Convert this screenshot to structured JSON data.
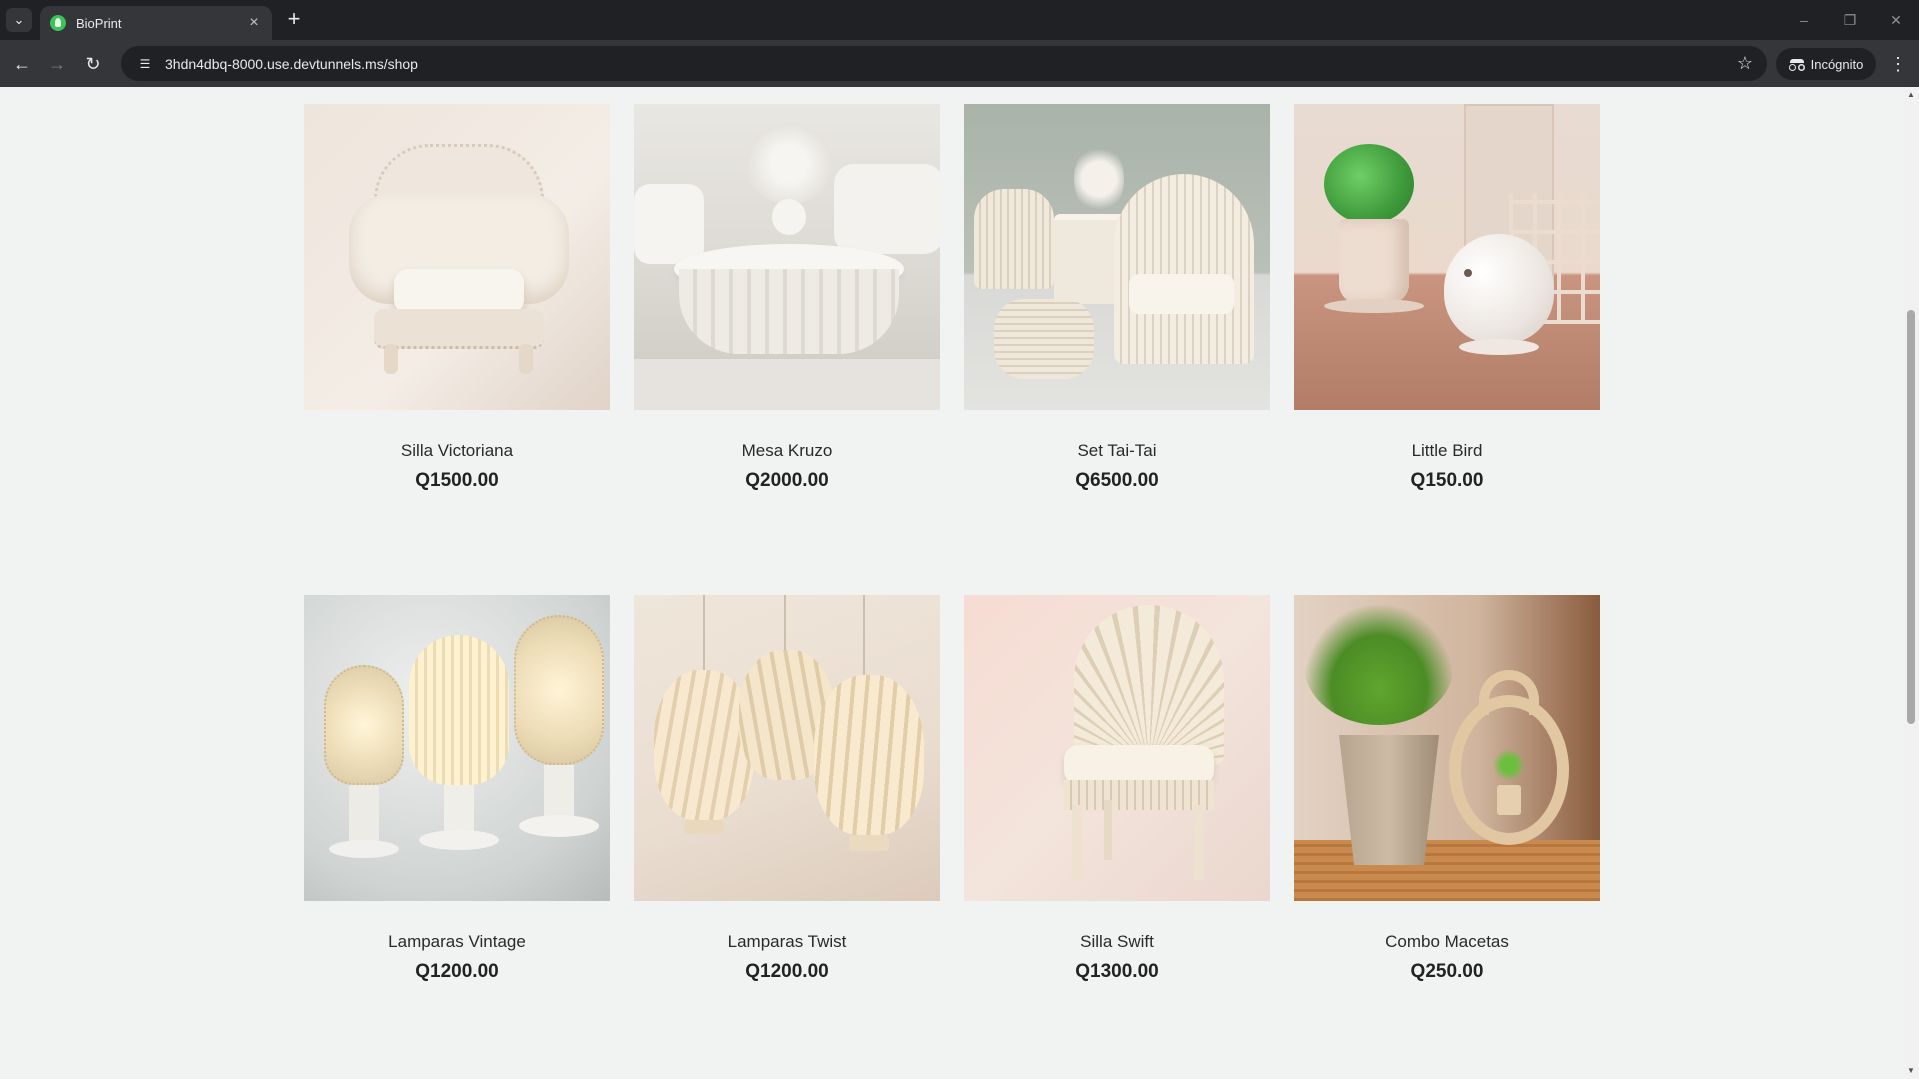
{
  "browser": {
    "tab_title": "BioPrint",
    "url": "3hdn4dbq-8000.use.devtunnels.ms/shop",
    "incognito_label": "Incógnito"
  },
  "products": [
    {
      "name": "Silla Victoriana",
      "price": "Q1500.00",
      "art": "chair-ornate"
    },
    {
      "name": "Mesa Kruzo",
      "price": "Q2000.00",
      "art": "round-table"
    },
    {
      "name": "Set Tai-Tai",
      "price": "Q6500.00",
      "art": "wicker-set"
    },
    {
      "name": "Little Bird",
      "price": "Q150.00",
      "art": "bird-planter"
    },
    {
      "name": "Lamparas Vintage",
      "price": "Q1200.00",
      "art": "table-lamps"
    },
    {
      "name": "Lamparas Twist",
      "price": "Q1200.00",
      "art": "pendant-lamps"
    },
    {
      "name": "Silla Swift",
      "price": "Q1300.00",
      "art": "fan-chair"
    },
    {
      "name": "Combo Macetas",
      "price": "Q250.00",
      "art": "planters"
    }
  ]
}
